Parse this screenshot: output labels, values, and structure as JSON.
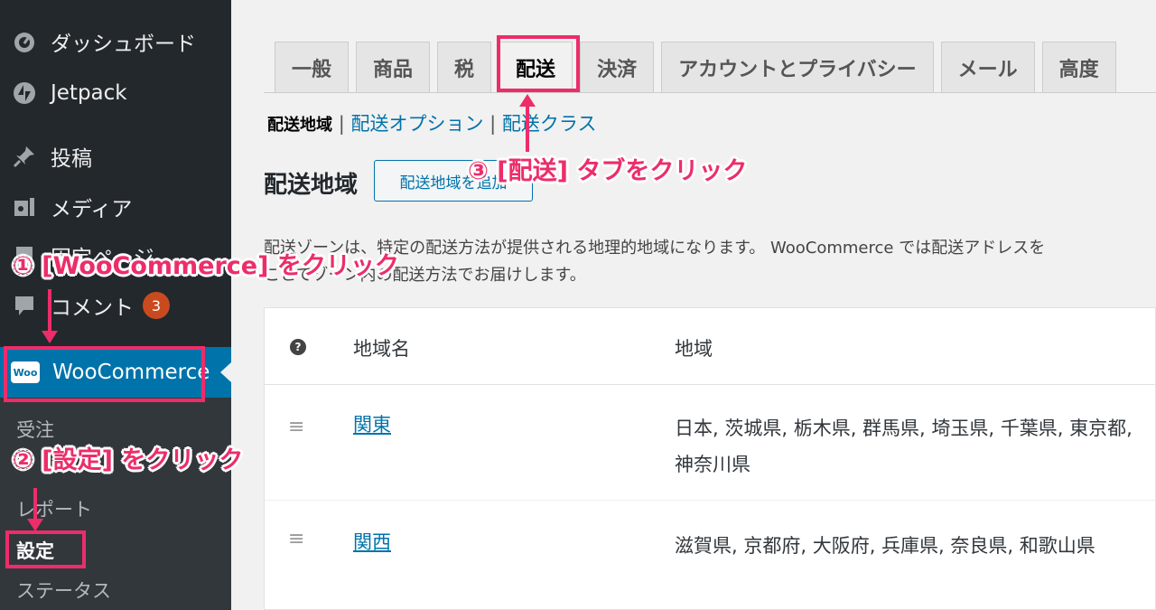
{
  "sidebar": {
    "dashboard": "ダッシュボード",
    "jetpack": "Jetpack",
    "posts": "投稿",
    "media": "メディア",
    "pages": "固定ページ",
    "comments": "コメント",
    "comments_badge": "3",
    "woocommerce": "WooCommerce",
    "woo_logo": "Woo",
    "submenu": {
      "orders": "受注",
      "reports": "レポート",
      "settings": "設定",
      "status": "ステータス"
    }
  },
  "tabs": [
    "一般",
    "商品",
    "税",
    "配送",
    "決済",
    "アカウントとプライバシー",
    "メール",
    "高度"
  ],
  "active_tab": "配送",
  "subsubsub": {
    "current": "配送地域",
    "options": "配送オプション",
    "classes": "配送クラス"
  },
  "page": {
    "heading": "配送地域",
    "add_button": "配送地域を追加",
    "description_line1": "配送ゾーンは、特定の配送方法が提供される地理的地域になります。 WooCommerce では配送アドレスを",
    "description_line2": "ことでゾーン内の配送方法でお届けします。"
  },
  "table": {
    "help_icon": "?",
    "col_name": "地域名",
    "col_region": "地域",
    "rows": [
      {
        "name": "関東",
        "region": "日本, 茨城県, 栃木県, 群馬県, 埼玉県, 千葉県, 東京都, 神奈川県"
      },
      {
        "name": "関西",
        "region": "滋賀県, 京都府, 大阪府, 兵庫県, 奈良県, 和歌山県"
      }
    ]
  },
  "annotations": {
    "step1": "① [WooCommerce] をクリック",
    "step2": "② [設定] をクリック",
    "step3": "③ [配送] タブをクリック"
  },
  "colors": {
    "sidebar_bg": "#23282d",
    "active_menu": "#0073aa",
    "annotation": "#ec2d6a",
    "link": "#0073aa"
  },
  "icons": [
    "dashboard-icon",
    "jetpack-icon",
    "pin-icon",
    "media-icon",
    "pages-icon",
    "comment-icon",
    "woo-icon",
    "help-icon",
    "drag-handle-icon"
  ]
}
